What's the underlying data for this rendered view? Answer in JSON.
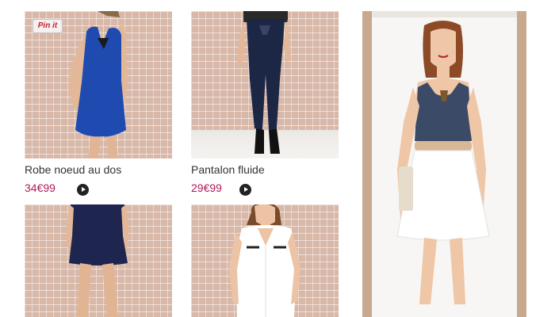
{
  "pin_button": {
    "label": "Pin it"
  },
  "products": [
    {
      "title": "Robe noeud au dos",
      "price": "34€99",
      "item_color": "#1e49a8"
    },
    {
      "title": "Pantalon fluide",
      "price": "29€99",
      "item_color": "#1a2342"
    },
    {
      "title": "",
      "price": "",
      "item_color": "#1e2650"
    },
    {
      "title": "",
      "price": "",
      "item_color": "#ffffff"
    }
  ],
  "colors": {
    "price": "#b01a59",
    "brick": "#d8b8a8",
    "play_icon": "#222222"
  }
}
